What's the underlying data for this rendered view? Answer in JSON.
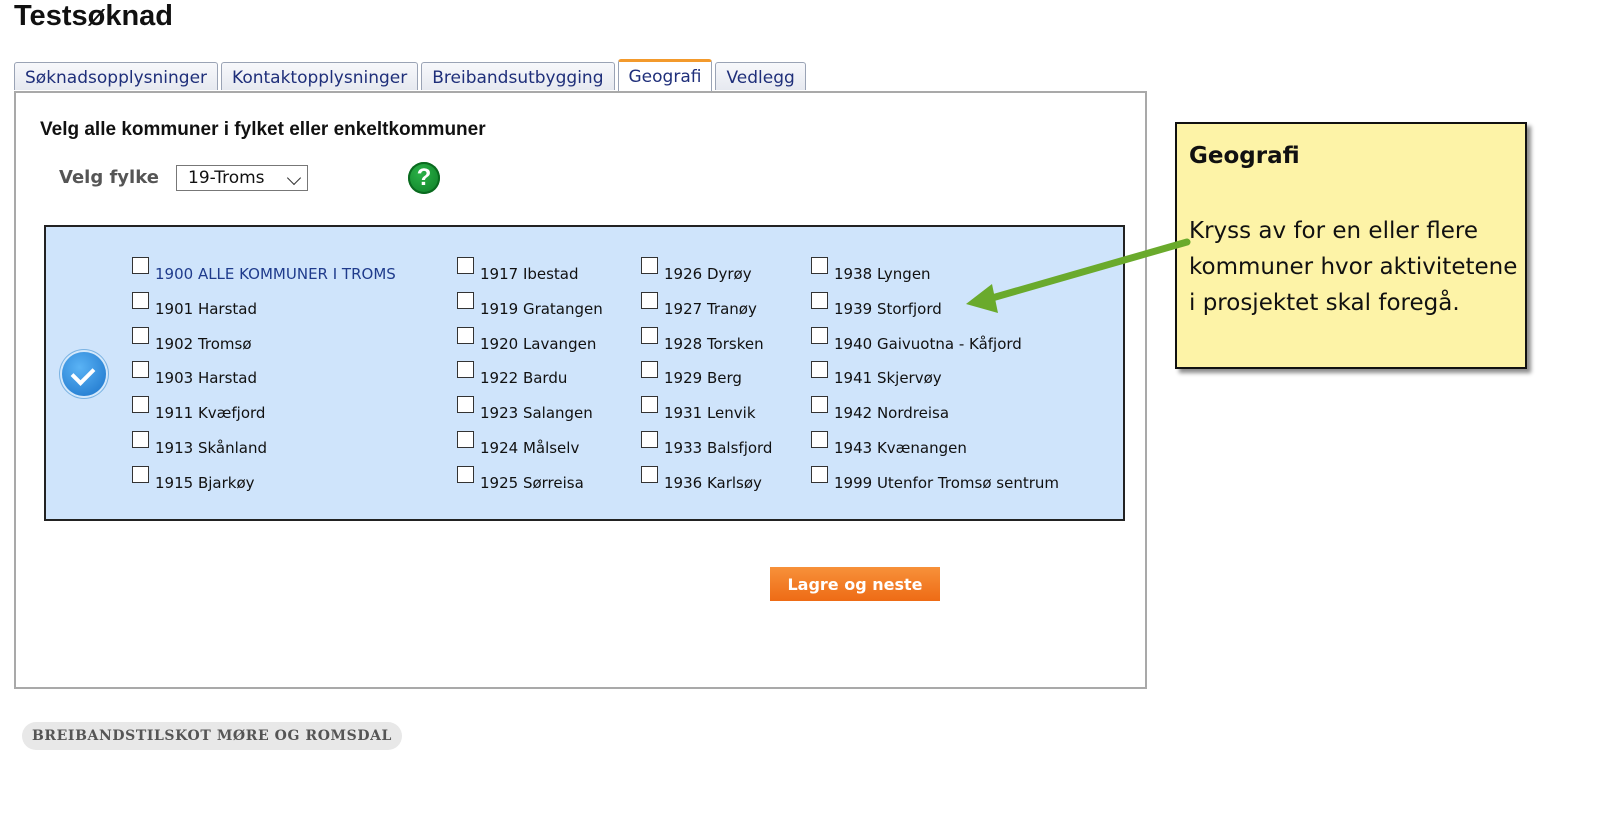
{
  "page": {
    "title": "Testsøknad"
  },
  "tabs": [
    {
      "label": "Søknadsopplysninger",
      "active": false
    },
    {
      "label": "Kontaktopplysninger",
      "active": false
    },
    {
      "label": "Breibandsutbygging",
      "active": false
    },
    {
      "label": "Geografi",
      "active": true
    },
    {
      "label": "Vedlegg",
      "active": false
    }
  ],
  "geografi": {
    "heading": "Velg alle kommuner i fylket eller enkeltkommuner",
    "fylke_label": "Velg fylke",
    "fylke_selected": "19-Troms",
    "help_symbol": "?",
    "select_all_icon": "check-circle-icon",
    "municipalities": [
      [
        "1900 ALLE KOMMUNER I TROMS",
        "1901 Harstad",
        "1902 Tromsø",
        "1903 Harstad",
        "1911 Kvæfjord",
        "1913 Skånland",
        "1915 Bjarkøy"
      ],
      [
        "1917 Ibestad",
        "1919 Gratangen",
        "1920 Lavangen",
        "1922 Bardu",
        "1923 Salangen",
        "1924 Målselv",
        "1925 Sørreisa"
      ],
      [
        "1926 Dyrøy",
        "1927 Tranøy",
        "1928 Torsken",
        "1929 Berg",
        "1931 Lenvik",
        "1933 Balsfjord",
        "1936 Karlsøy"
      ],
      [
        "1938 Lyngen",
        "1939 Storfjord",
        "1940 Gaivuotna - Kåfjord",
        "1941 Skjervøy",
        "1942 Nordreisa",
        "1943 Kvænangen",
        "1999 Utenfor Tromsø sentrum"
      ]
    ],
    "save_label": "Lagre og neste"
  },
  "footer": {
    "label": "BREIBANDSTILSKOT MØRE OG ROMSDAL"
  },
  "callout": {
    "title": "Geografi",
    "body": "Kryss av for en eller flere kommuner hvor aktivitetene i prosjektet skal foregå."
  },
  "colors": {
    "accent_tab": "#f39a2c",
    "save_button": "#f0771f",
    "box_bg": "#cfe4fb",
    "callout_bg": "#fdf3a7",
    "arrow": "#6aaa2c"
  }
}
